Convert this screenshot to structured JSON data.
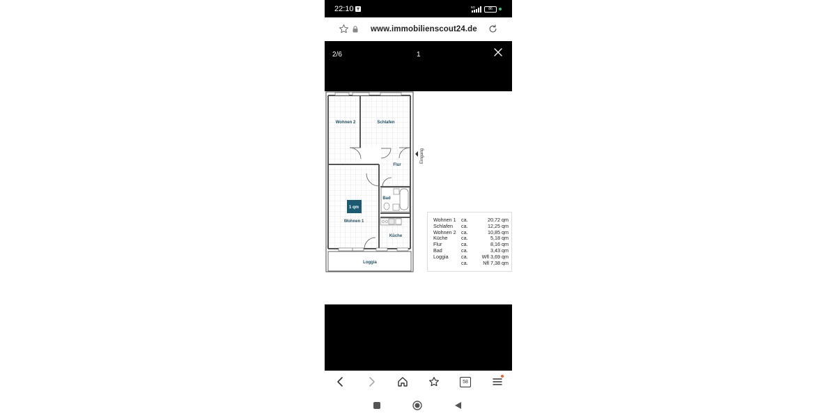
{
  "status_bar": {
    "time": "22:10",
    "battery": "86",
    "network": "5G"
  },
  "browser": {
    "url": "www.immobilienscout24.de"
  },
  "viewer": {
    "counter": "2/6",
    "image_title": "1"
  },
  "floorplan": {
    "rooms": {
      "wohnen2": "Wohnen 2",
      "schlafen": "Schlafen",
      "flur": "Flur",
      "bad": "Bad",
      "wohnen1": "Wohnen 1",
      "kueche": "Küche",
      "loggia": "Loggia",
      "scale": "1 qm",
      "eingang": "Eingang"
    },
    "areas": [
      {
        "name": "Wohnen 1",
        "ca": "ca.",
        "value": "20,72 qm"
      },
      {
        "name": "Schlafen",
        "ca": "ca.",
        "value": "12,25 qm"
      },
      {
        "name": "Wohnen 2",
        "ca": "ca.",
        "value": "10,85 qm"
      },
      {
        "name": "Küche",
        "ca": "ca.",
        "value": "5,18 qm"
      },
      {
        "name": "Flur",
        "ca": "ca.",
        "value": "8,16 qm"
      },
      {
        "name": "Bad",
        "ca": "ca.",
        "value": "3,43 qm"
      },
      {
        "name": "Loggia",
        "ca": "ca.",
        "value": "Wfl 3,69 qm"
      },
      {
        "name": "",
        "ca": "ca.",
        "value": "Nfl 7,38 qm"
      }
    ]
  },
  "bottom_nav": {
    "tabs_count": "58"
  },
  "colors": {
    "accent_dot": "#ff5a1f",
    "battery_dot": "#3fc36b",
    "room_label": "#1f4f66",
    "scale_box": "#1a5a72"
  }
}
